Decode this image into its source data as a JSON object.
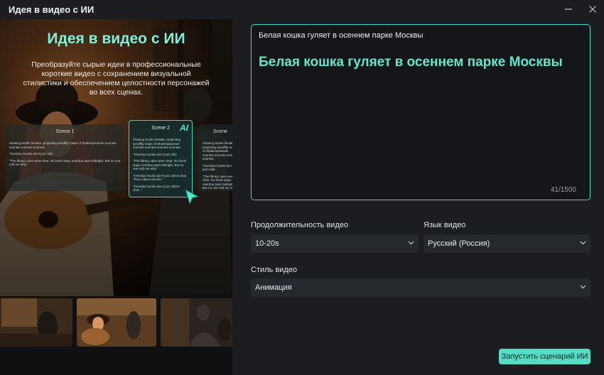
{
  "window": {
    "title": "Идея в видео с ИИ"
  },
  "promo": {
    "title": "Идея в видео с ИИ",
    "description": "Преобразуйте сырые идеи в профессиональные короткие видео с сохранением визуальной стилистики и обеспечением целостности персонажей во всех сценах.",
    "scene_left_label": "Scene 1",
    "scene_center_label": "Scene 2",
    "scene_right_label": "Scene",
    "ai_badge": "AI",
    "card_text": {
      "p1": "Glowing books levitate, projecting wordflip maps of Shakespearean sonnets sonnets sonnets sonnets.",
      "p2": "\"Overdue books don't just colle",
      "p3": "\"The library rules were clear. No book stays overdue past midnight. But no one told me why.\"",
      "p4": "\"Overdue books don't just collect dust. They collect secrets.\"",
      "p5": "\"Overdue books don't just collect dust...\""
    }
  },
  "prompt": {
    "input_text": "Белая кошка гуляет в осеннем парке Москвы",
    "preview_text": "Белая кошка гуляет в осеннем парке Москвы",
    "counter": "41/1500"
  },
  "form": {
    "duration_label": "Продолжительность видео",
    "duration_value": "10-20s",
    "language_label": "Язык видео",
    "language_value": "Русский (Россия)",
    "style_label": "Стиль видео",
    "style_value": "Анимация"
  },
  "actions": {
    "run_label": "Запустить сценарий ИИ"
  },
  "colors": {
    "accent": "#3fdcc2",
    "button": "#56dcc3",
    "background": "#1b1d21"
  }
}
